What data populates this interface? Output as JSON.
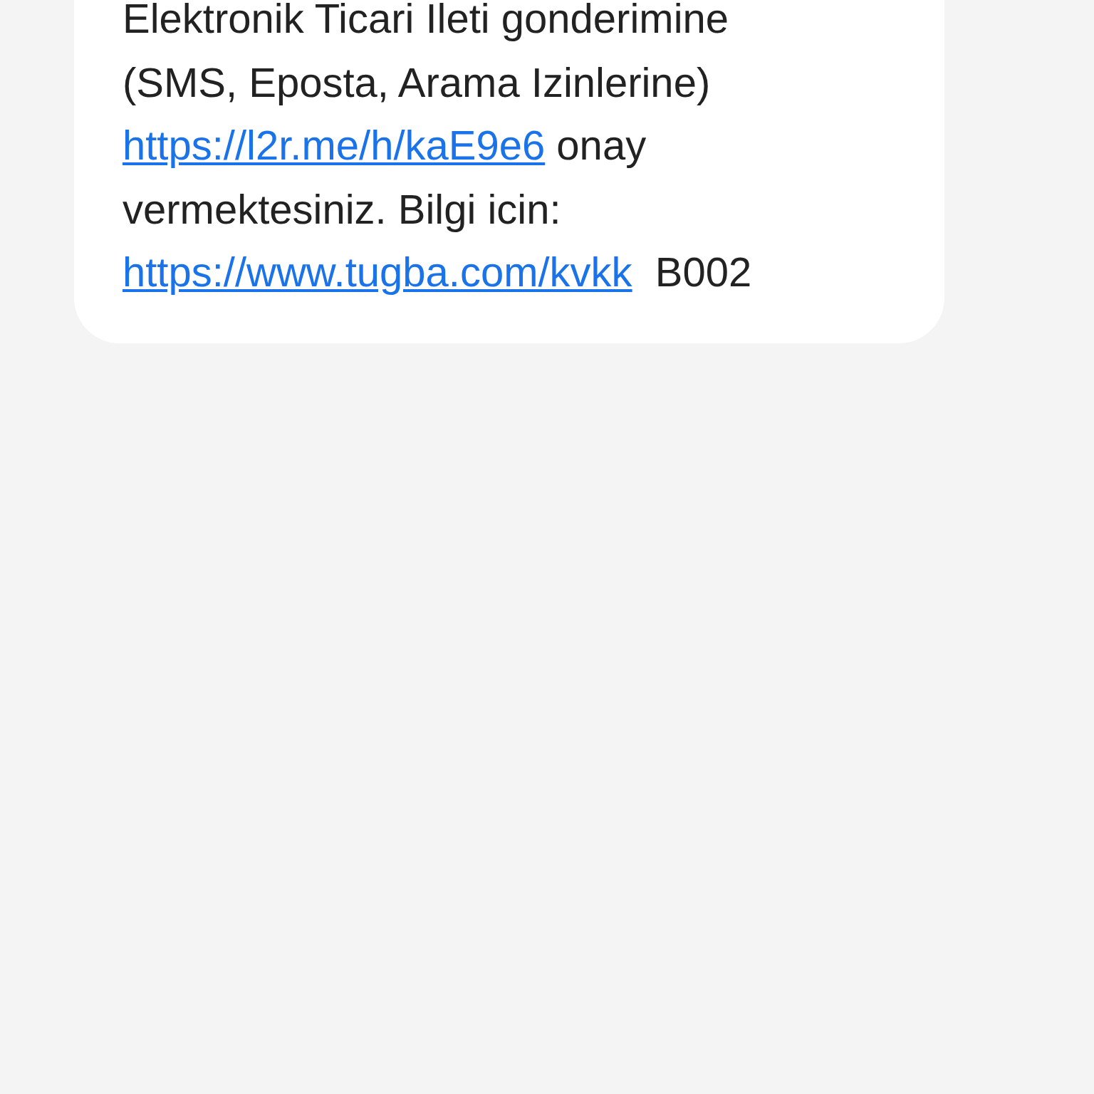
{
  "message": {
    "lines": [
      [
        {
          "kind": "text",
          "text": "Elektronik Ticari Ileti gonderimine"
        }
      ],
      [
        {
          "kind": "text",
          "text": "(SMS, Eposta, Arama Izinlerine)"
        }
      ],
      [
        {
          "kind": "link",
          "text": "https://l2r.me/h/kaE9e6"
        },
        {
          "kind": "text",
          "text": " onay"
        }
      ],
      [
        {
          "kind": "text",
          "text": "vermektesiniz. Bilgi icin:"
        }
      ],
      [
        {
          "kind": "link",
          "text": "https://www.tugba.com/kvkk"
        },
        {
          "kind": "text",
          "text": "  B002"
        }
      ]
    ]
  }
}
